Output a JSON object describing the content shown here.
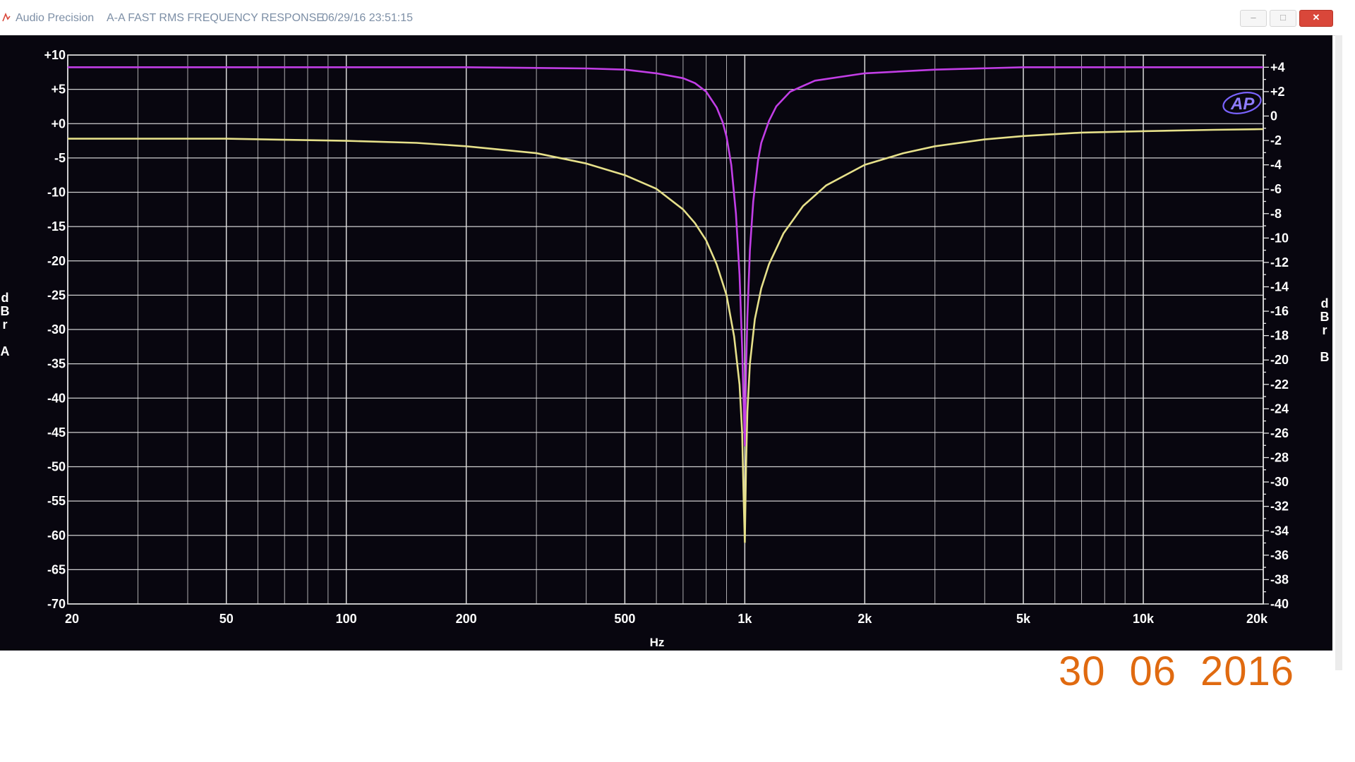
{
  "window": {
    "app_name": "Audio Precision",
    "measurement_title": "A-A FAST RMS FREQUENCY RESPONSE",
    "timestamp": "06/29/16 23:51:15",
    "minimize_glyph": "–",
    "maximize_glyph": "□",
    "close_glyph": "✕"
  },
  "photo_date_stamp": {
    "day": "30",
    "month": "06",
    "year": "2016"
  },
  "colors": {
    "plot_background": "#08060f",
    "grid": "#e6e6e6",
    "axis_text": "#ffffff",
    "series_a": "#e6e08a",
    "series_b": "#c23ee6",
    "close_button": "#d9473a",
    "date_stamp": "#e06a10"
  },
  "icons": {
    "app": "audio-precision-icon",
    "logo": "ap-logo"
  },
  "logo_text": "AP",
  "chart_data": {
    "type": "line",
    "x_scale": "log",
    "xlim": [
      20,
      20000
    ],
    "xlabel": "Hz",
    "x_ticks": [
      {
        "value": 20,
        "label": "20"
      },
      {
        "value": 50,
        "label": "50"
      },
      {
        "value": 100,
        "label": "100"
      },
      {
        "value": 200,
        "label": "200"
      },
      {
        "value": 500,
        "label": "500"
      },
      {
        "value": 1000,
        "label": "1k"
      },
      {
        "value": 2000,
        "label": "2k"
      },
      {
        "value": 5000,
        "label": "5k"
      },
      {
        "value": 10000,
        "label": "10k"
      },
      {
        "value": 20000,
        "label": "20k"
      }
    ],
    "ylim_left": [
      -70,
      10
    ],
    "ylabel_left": [
      "d",
      "B",
      "r",
      "",
      "A"
    ],
    "y_ticks_left": [
      "+10",
      "+5",
      "+0",
      "-5",
      "-10",
      "-15",
      "-20",
      "-25",
      "-30",
      "-35",
      "-40",
      "-45",
      "-50",
      "-55",
      "-60",
      "-65",
      "-70"
    ],
    "ylim_right": [
      -40,
      5
    ],
    "ylabel_right": [
      "d",
      "B",
      "r",
      "",
      "B"
    ],
    "y_ticks_right": [
      "+4",
      "+2",
      "0",
      "-2",
      "-4",
      "-6",
      "-8",
      "-10",
      "-12",
      "-14",
      "-16",
      "-18",
      "-20",
      "-22",
      "-24",
      "-26",
      "-28",
      "-30",
      "-32",
      "-34",
      "-36",
      "-38",
      "-40"
    ],
    "grid": true,
    "series": [
      {
        "axis": "left",
        "color": "#e6e08a",
        "x": [
          20,
          50,
          100,
          150,
          200,
          300,
          400,
          500,
          600,
          700,
          750,
          800,
          850,
          900,
          940,
          970,
          985,
          993,
          1000,
          1007,
          1015,
          1030,
          1060,
          1100,
          1150,
          1250,
          1400,
          1600,
          2000,
          2500,
          3000,
          4000,
          5000,
          7000,
          10000,
          15000,
          20000
        ],
        "y": [
          -2.2,
          -2.2,
          -2.5,
          -2.8,
          -3.3,
          -4.3,
          -5.8,
          -7.5,
          -9.5,
          -12.5,
          -14.5,
          -17,
          -20.5,
          -25,
          -31,
          -38,
          -45,
          -54,
          -61,
          -50,
          -42,
          -35,
          -28.5,
          -24,
          -20.5,
          -16,
          -12,
          -9,
          -6,
          -4.3,
          -3.3,
          -2.3,
          -1.8,
          -1.3,
          -1.1,
          -0.9,
          -0.8
        ]
      },
      {
        "axis": "right",
        "color": "#c23ee6",
        "x": [
          20,
          100,
          200,
          400,
          500,
          600,
          700,
          750,
          800,
          850,
          880,
          900,
          925,
          950,
          970,
          985,
          993,
          1000,
          1007,
          1015,
          1030,
          1050,
          1080,
          1100,
          1150,
          1200,
          1300,
          1500,
          2000,
          3000,
          5000,
          10000,
          20000
        ],
        "y": [
          4,
          4,
          4,
          3.9,
          3.8,
          3.5,
          3.1,
          2.7,
          2,
          0.7,
          -0.5,
          -1.7,
          -4,
          -8,
          -13,
          -19,
          -23.5,
          -27,
          -21,
          -16.5,
          -11,
          -7,
          -3.6,
          -2.2,
          -0.4,
          0.8,
          2,
          2.9,
          3.5,
          3.8,
          4,
          4,
          4
        ]
      }
    ]
  }
}
